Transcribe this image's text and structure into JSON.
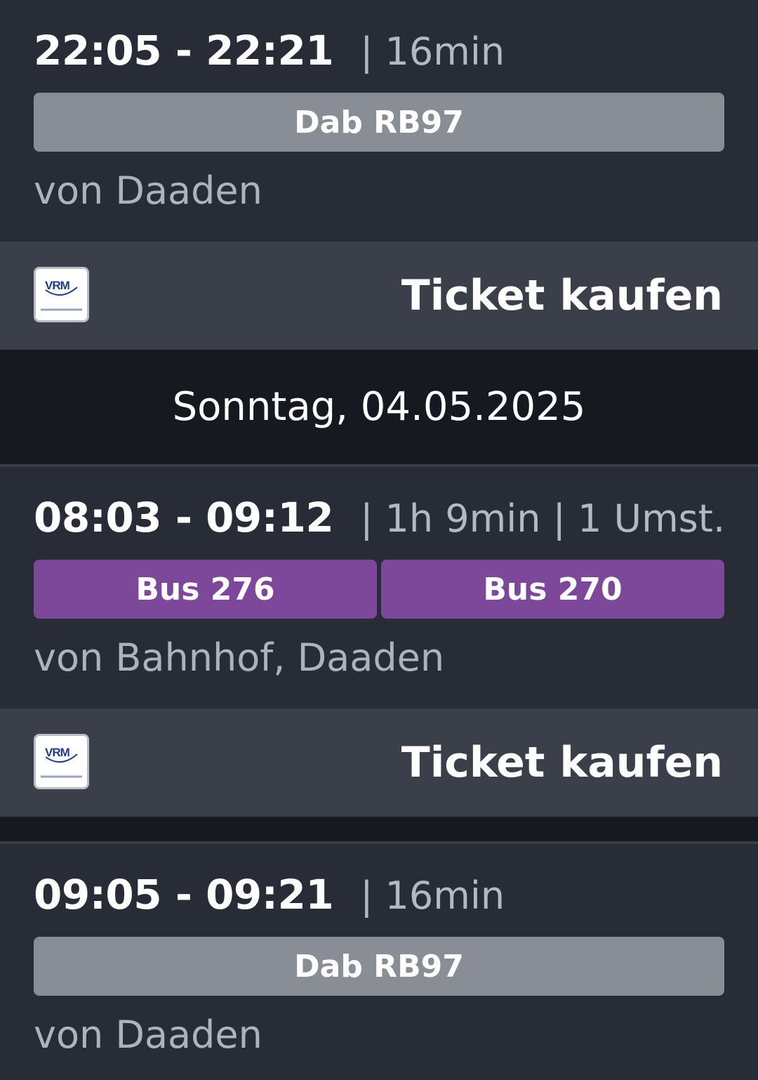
{
  "connections": [
    {
      "time_range": "22:05 - 22:21",
      "details": "| 16min",
      "lines": [
        "Dab RB97"
      ],
      "origin": "von Daaden",
      "ticket_label": "Ticket kaufen",
      "ticket_logo": "vrm-logo"
    },
    {
      "time_range": "08:03 - 09:12",
      "details": "| 1h 9min | 1 Umst.",
      "lines": [
        "Bus 276",
        "Bus 270"
      ],
      "origin": "von Bahnhof, Daaden",
      "ticket_label": "Ticket kaufen",
      "ticket_logo": "vrm-logo"
    },
    {
      "time_range": "09:05 - 09:21",
      "details": "| 16min",
      "lines": [
        "Dab RB97"
      ],
      "origin": "von Daaden"
    }
  ],
  "date_header": "Sonntag, 04.05.2025",
  "colors": {
    "background": "#282c37",
    "ticket_row": "#3b3f4a",
    "date_header": "#161920",
    "train_chip": "#898d96",
    "bus_chip": "#7e489a",
    "vrm_brand": "#1f3a8a"
  }
}
